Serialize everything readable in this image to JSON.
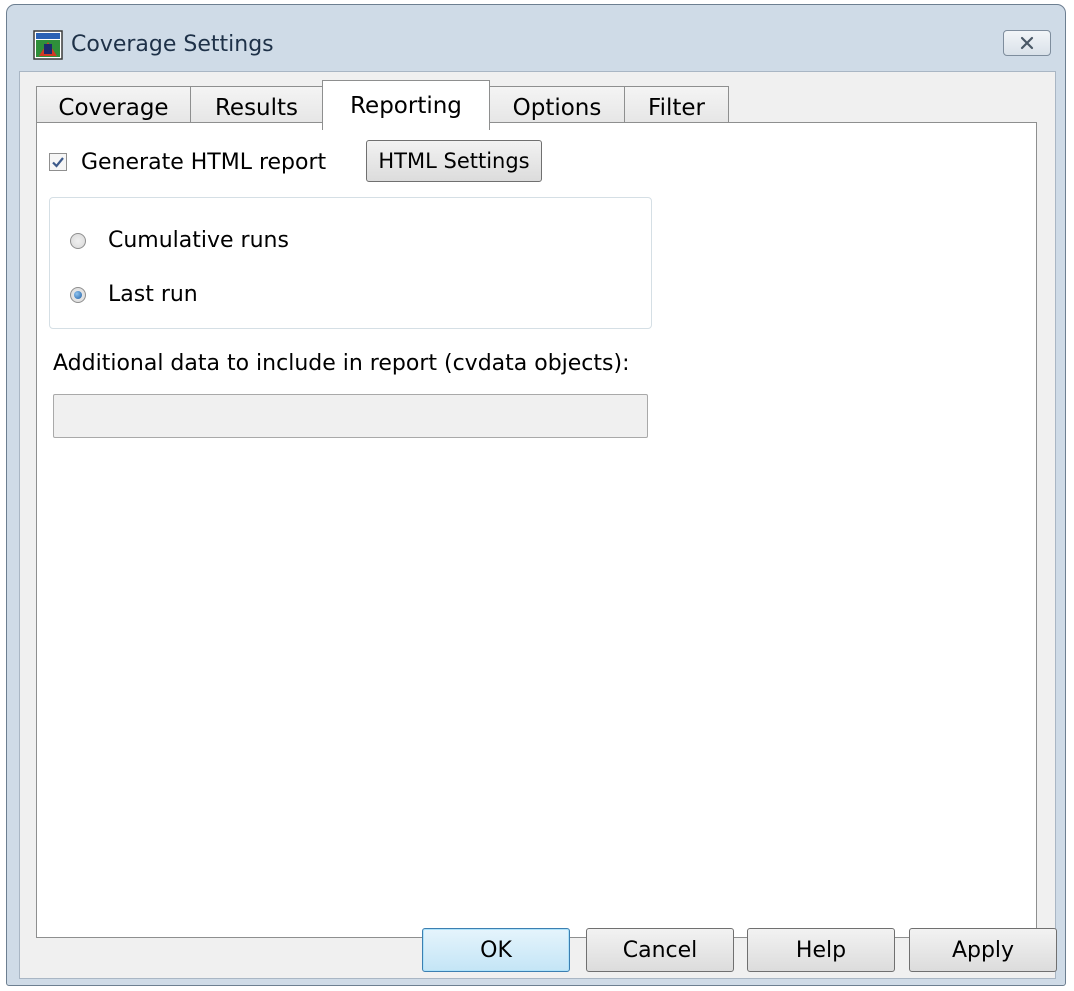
{
  "window": {
    "title": "Coverage Settings",
    "icon": "coverage-app-icon",
    "close_icon": "close-icon"
  },
  "tabs": [
    {
      "label": "Coverage"
    },
    {
      "label": "Results"
    },
    {
      "label": "Reporting",
      "active": true
    },
    {
      "label": "Options"
    },
    {
      "label": "Filter"
    }
  ],
  "reporting": {
    "generate_html": {
      "label": "Generate HTML report",
      "checked": true
    },
    "html_settings_button": "HTML Settings",
    "radios": [
      {
        "label": "Cumulative runs",
        "selected": false
      },
      {
        "label": "Last run",
        "selected": true
      }
    ],
    "additional_data_label": "Additional data to include in report (cvdata objects):",
    "additional_data_value": ""
  },
  "buttons": {
    "ok": "OK",
    "cancel": "Cancel",
    "help": "Help",
    "apply": "Apply"
  },
  "colors": {
    "window_frame": "#cfdbe7",
    "client_bg": "#f0f0f0",
    "default_button": "#c4e5f6"
  }
}
